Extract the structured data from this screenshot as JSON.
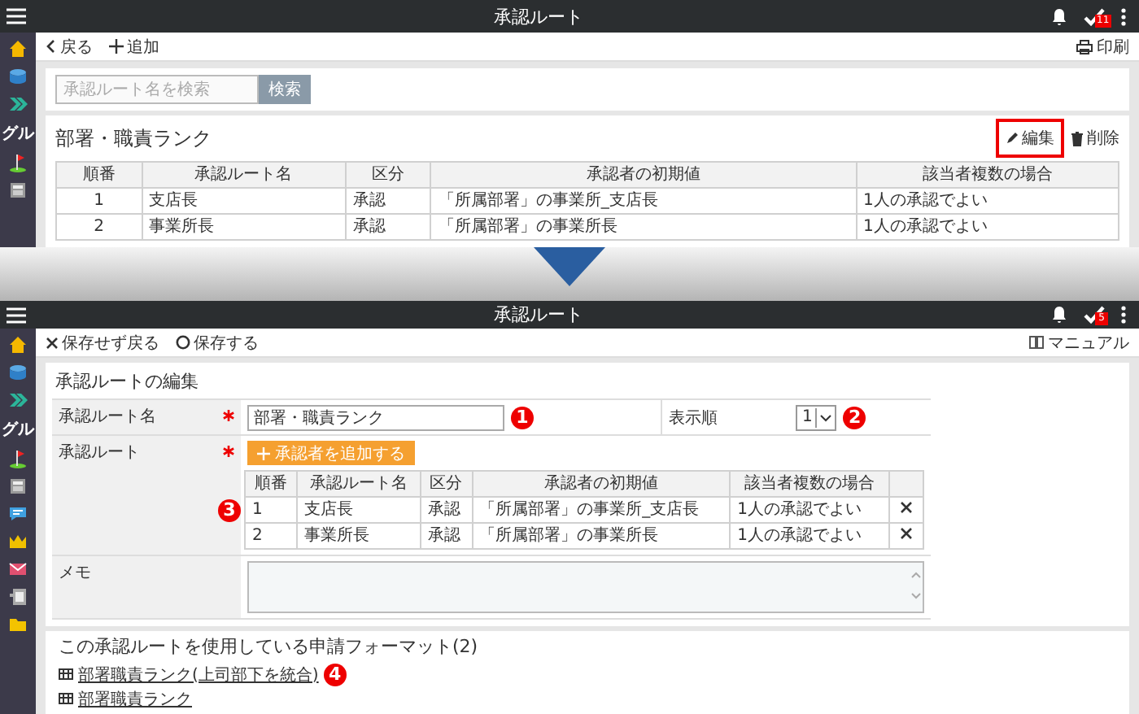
{
  "top_screen": {
    "header": {
      "title": "承認ルート",
      "task_count": "11"
    },
    "sidebar": {
      "label": "グル"
    },
    "toolbar": {
      "back": "戻る",
      "add": "追加",
      "print": "印刷"
    },
    "search": {
      "placeholder": "承認ルート名を検索",
      "button": "検索"
    },
    "route": {
      "title": "部署・職責ランク",
      "edit": "編集",
      "edit_highlighted": true,
      "delete": "削除",
      "table": {
        "columns": [
          "順番",
          "承認ルート名",
          "区分",
          "承認者の初期値",
          "該当者複数の場合"
        ],
        "rows": [
          [
            "1",
            "支店長",
            "承認",
            "「所属部署」の事業所_支店長",
            "1人の承認でよい"
          ],
          [
            "2",
            "事業所長",
            "承認",
            "「所属部署」の事業所長",
            "1人の承認でよい"
          ]
        ]
      }
    }
  },
  "bottom_screen": {
    "header": {
      "title": "承認ルート",
      "task_count": "5"
    },
    "sidebar": {
      "label": "グル"
    },
    "toolbar": {
      "discard": "保存せず戻る",
      "save": "保存する",
      "manual": "マニュアル"
    },
    "form": {
      "title": "承認ルートの編集",
      "name": {
        "label": "承認ルート名",
        "required": true,
        "value": "部署・職責ランク",
        "callout": "1"
      },
      "order": {
        "label": "表示順",
        "value": "1",
        "callout": "2"
      },
      "route": {
        "label": "承認ルート",
        "required": true,
        "add_button": "承認者を追加する",
        "callout": "3",
        "table": {
          "columns": [
            "順番",
            "承認ルート名",
            "区分",
            "承認者の初期値",
            "該当者複数の場合"
          ],
          "rows": [
            [
              "1",
              "支店長",
              "承認",
              "「所属部署」の事業所_支店長",
              "1人の承認でよい"
            ],
            [
              "2",
              "事業所長",
              "承認",
              "「所属部署」の事業所長",
              "1人の承認でよい"
            ]
          ]
        }
      },
      "memo": {
        "label": "メモ"
      }
    },
    "formats": {
      "title": "この承認ルートを使用している申請フォーマット(2)",
      "links": [
        {
          "label": "部署職責ランク(上司部下を統合)",
          "callout": "4"
        },
        {
          "label": "部署職責ランク"
        }
      ]
    }
  }
}
